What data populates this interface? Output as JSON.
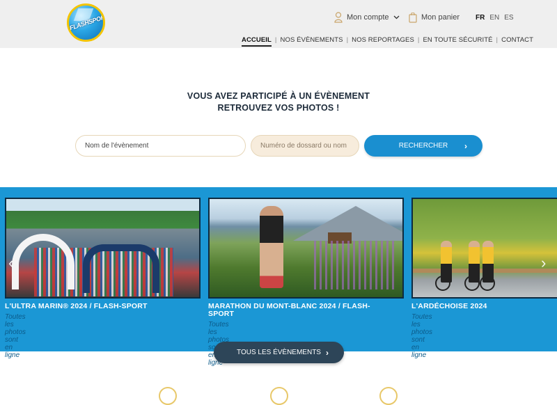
{
  "header": {
    "logo_text": "FLASHSPORT",
    "account_label": "Mon compte",
    "cart_label": "Mon panier",
    "languages": [
      "FR",
      "EN",
      "ES"
    ],
    "active_language": "FR",
    "nav": [
      "ACCUEIL",
      "NOS ÉVÈNEMENTS",
      "NOS REPORTAGES",
      "EN TOUTE SÉCURITÉ",
      "CONTACT"
    ],
    "active_nav": "ACCUEIL"
  },
  "hero": {
    "title_line1": "VOUS AVEZ PARTICIPÉ À UN ÉVÈNEMENT",
    "title_line2": "RETROUVEZ VOS PHOTOS !"
  },
  "search": {
    "event_placeholder": "Nom de l'évènement",
    "bib_placeholder": "Numéro de dossard ou nom",
    "button_label": "RECHERCHER"
  },
  "events": [
    {
      "title": "L'ULTRA MARIN® 2024 / FLASH-SPORT",
      "subtitle": "Toutes les photos sont en ligne"
    },
    {
      "title": "MARATHON DU MONT-BLANC 2024 / FLASH-SPORT",
      "subtitle": "Toutes les photos sont en ligne"
    },
    {
      "title": "L'ARDÉCHOISE 2024",
      "subtitle": "Toutes les photos sont en ligne"
    }
  ],
  "all_events_label": "TOUS LES ÉVÈNEMENTS",
  "colors": {
    "accent_blue": "#1b97d5",
    "dark_button": "#2d4558",
    "logo_gold": "#f3c400"
  },
  "icons": {
    "account": "user-icon",
    "cart": "cart-icon",
    "search_chevron": "chevron-right-icon",
    "carousel_prev": "chevron-left-icon",
    "carousel_next": "chevron-right-icon"
  }
}
